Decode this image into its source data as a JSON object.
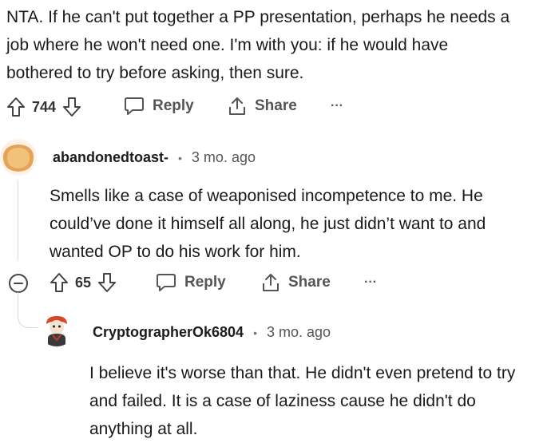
{
  "comments": [
    {
      "text": "NTA. If he can't put together a PP presentation, perhaps he needs a job where he won't need one. I'm with you: if he would have bothered to try before asking, then sure.",
      "lines": [
        "NTA. If he can't put together a PP presentation, perhaps he needs a",
        "job where he won't need one. I'm with you: if he would have",
        "bothered to try before asking, then sure."
      ],
      "votes": "744",
      "reply_label": "Reply",
      "share_label": "Share",
      "more_label": "···"
    },
    {
      "username": "abandonedtoast-",
      "separator": "•",
      "timestamp": "3 mo. ago",
      "lines": [
        "Smells like a case of weaponised incompetence to me. He",
        "could’ve done it himself all along, he just didn’t want to and",
        "wanted OP to do his work for him."
      ],
      "votes": "65",
      "reply_label": "Reply",
      "share_label": "Share",
      "more_label": "···"
    },
    {
      "username": "CryptographerOk6804",
      "separator": "•",
      "timestamp": "3 mo. ago",
      "lines": [
        "I believe it's worse than that. He didn't even pretend to try",
        "and failed. It is a case of laziness cause he didn't do",
        "anything at all."
      ]
    }
  ],
  "icons": {
    "upvote": "arrow-up-icon",
    "downvote": "arrow-down-icon",
    "reply": "speech-bubble-icon",
    "share": "share-icon",
    "collapse": "collapse-minus-icon",
    "more": "ellipsis-icon"
  }
}
